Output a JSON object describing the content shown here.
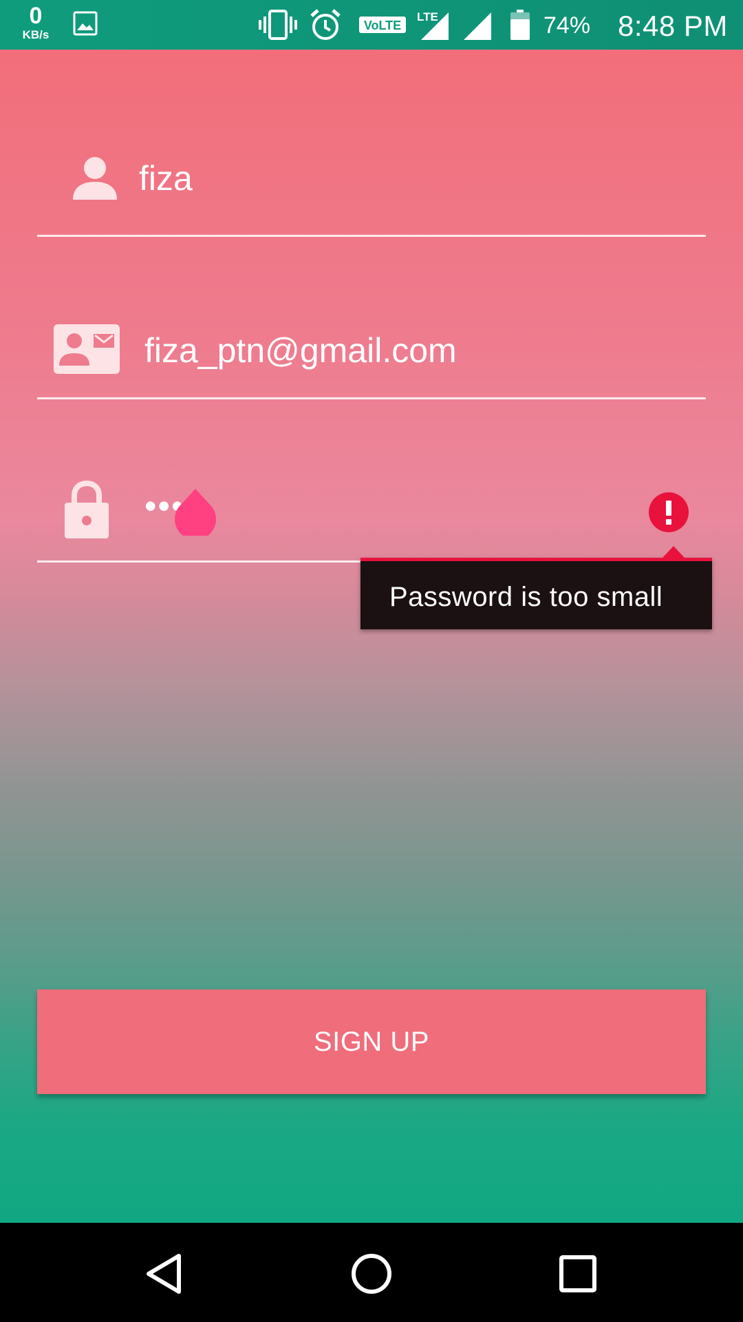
{
  "status_bar": {
    "net_speed_value": "0",
    "net_speed_unit": "KB/s",
    "battery_percent": "74%",
    "time": "8:48 PM",
    "volte_label": "VoLTE",
    "lte_label": "LTE",
    "icons": [
      "gallery-icon",
      "vibrate-icon",
      "alarm-icon",
      "volte-icon",
      "lte-signal-icon",
      "signal-icon",
      "battery-icon"
    ]
  },
  "form": {
    "name": {
      "value": "fiza",
      "icon": "person-icon"
    },
    "email": {
      "value": "fiza_ptn@gmail.com",
      "icon": "contact-card-icon"
    },
    "password": {
      "value": "••••",
      "icon": "lock-icon"
    },
    "error": {
      "message": "Password is too small",
      "icon": "error-icon"
    },
    "signup_label": "SIGN UP"
  },
  "colors": {
    "accent": "#ff4081",
    "error": "#e8123d",
    "button": "#f06d7b",
    "status_bar": "#0f9c7d"
  },
  "nav_bar": {
    "icons": [
      "back-icon",
      "home-icon",
      "recents-icon"
    ]
  }
}
